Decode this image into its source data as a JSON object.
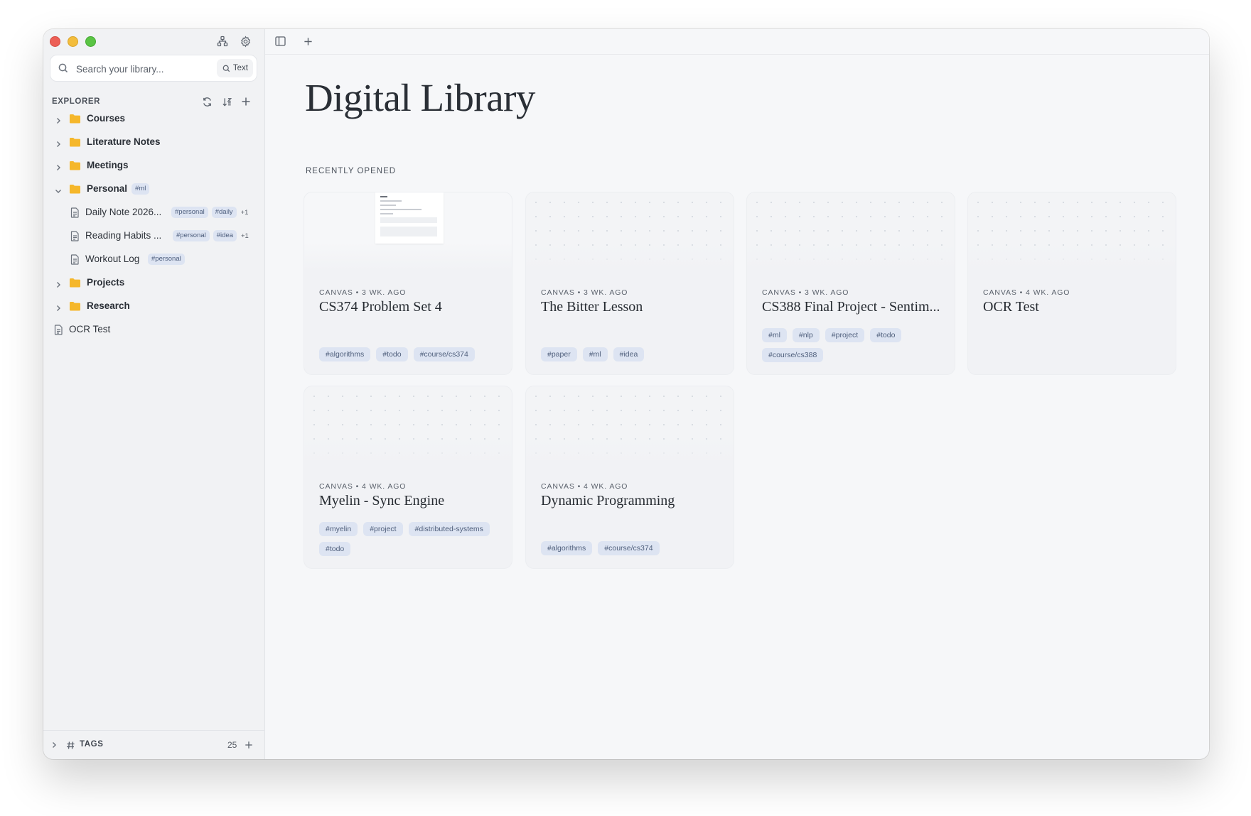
{
  "search": {
    "placeholder": "Search your library...",
    "mode_label": "Text"
  },
  "explorer": {
    "title": "EXPLORER",
    "folders": [
      {
        "name": "Courses"
      },
      {
        "name": "Literature Notes"
      },
      {
        "name": "Meetings"
      },
      {
        "name": "Personal",
        "tag": "#ml"
      },
      {
        "name": "Projects"
      },
      {
        "name": "Research"
      }
    ],
    "personal_files": [
      {
        "name": "Daily Note 2026...",
        "tags": [
          "#personal",
          "#daily"
        ],
        "more": "+1"
      },
      {
        "name": "Reading Habits ...",
        "tags": [
          "#personal",
          "#idea"
        ],
        "more": "+1"
      },
      {
        "name": "Workout Log",
        "tags": [
          "#personal"
        ]
      }
    ],
    "root_files": [
      {
        "name": "OCR Test"
      }
    ]
  },
  "tags_section": {
    "label": "TAGS",
    "count": "25"
  },
  "main": {
    "title": "Digital Library",
    "section": "RECENTLY OPENED",
    "cards": [
      {
        "meta": "CANVAS • 3 WK. AGO",
        "title": "CS374 Problem Set 4",
        "tags": [
          "#algorithms",
          "#todo",
          "#course/cs374"
        ]
      },
      {
        "meta": "CANVAS • 3 WK. AGO",
        "title": "The Bitter Lesson",
        "tags": [
          "#paper",
          "#ml",
          "#idea"
        ]
      },
      {
        "meta": "CANVAS • 3 WK. AGO",
        "title": "CS388 Final Project - Sentim...",
        "tags": [
          "#ml",
          "#nlp",
          "#project",
          "#todo",
          "#course/cs388"
        ]
      },
      {
        "meta": "CANVAS • 4 WK. AGO",
        "title": "OCR Test",
        "tags": []
      },
      {
        "meta": "CANVAS • 4 WK. AGO",
        "title": "Myelin - Sync Engine",
        "tags": [
          "#myelin",
          "#project",
          "#distributed-systems",
          "#todo"
        ]
      },
      {
        "meta": "CANVAS • 4 WK. AGO",
        "title": "Dynamic Programming",
        "tags": [
          "#algorithms",
          "#course/cs374"
        ]
      }
    ]
  },
  "colors": {
    "accent_tag_bg": "#dde4f2",
    "folder": "#f5b72b",
    "close": "#ec5f56",
    "minimize": "#f3bd3c",
    "zoom": "#5ac444"
  }
}
